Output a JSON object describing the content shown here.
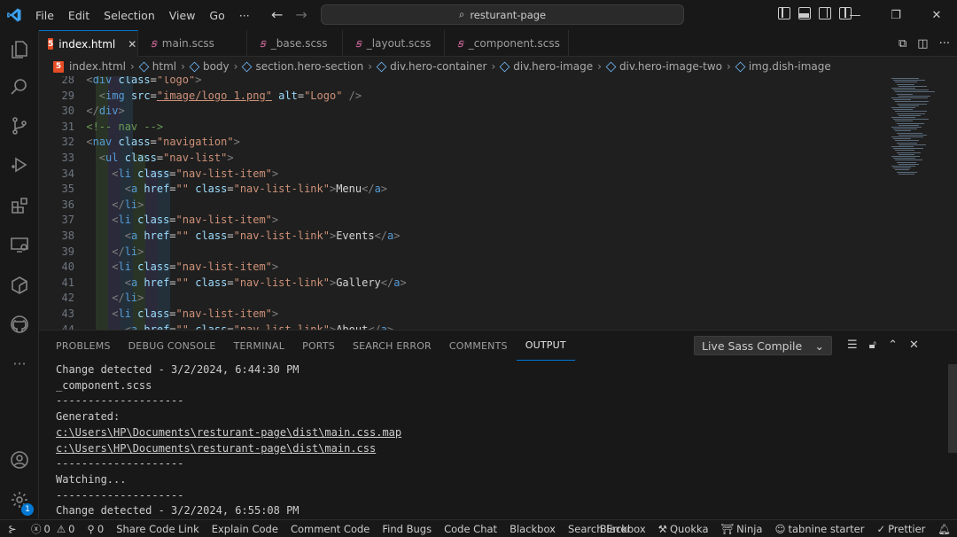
{
  "titlebar": {
    "menu": [
      "File",
      "Edit",
      "Selection",
      "View",
      "Go",
      "···"
    ],
    "search": "resturant-page"
  },
  "tabs": [
    {
      "label": "index.html",
      "kind": "html"
    },
    {
      "label": "main.scss",
      "kind": "scss"
    },
    {
      "label": "_base.scss",
      "kind": "scss"
    },
    {
      "label": "_layout.scss",
      "kind": "scss"
    },
    {
      "label": "_component.scss",
      "kind": "scss"
    }
  ],
  "breadcrumb": [
    "index.html",
    "html",
    "body",
    "section.hero-section",
    "div.hero-container",
    "div.hero-image",
    "div.hero-image-two",
    "img.dish-image"
  ],
  "editor": {
    "line_numbers": [
      "28",
      "29",
      "30",
      "31",
      "32",
      "33",
      "34",
      "35",
      "36",
      "37",
      "38",
      "39",
      "40",
      "41",
      "42",
      "43",
      "44"
    ]
  },
  "panel": {
    "tabs": [
      "PROBLEMS",
      "DEBUG CONSOLE",
      "TERMINAL",
      "PORTS",
      "SEARCH ERROR",
      "COMMENTS",
      "OUTPUT"
    ],
    "active_tab": "OUTPUT",
    "channel": "Live Sass Compile",
    "output": [
      "Change detected - 3/2/2024, 6:44:30 PM",
      "_component.scss",
      "--------------------",
      "Generated:",
      "c:\\Users\\HP\\Documents\\resturant-page\\dist\\main.css.map",
      "c:\\Users\\HP\\Documents\\resturant-page\\dist\\main.css",
      "--------------------",
      "Watching...",
      "--------------------",
      "Change detected - 3/2/2024, 6:55:08 PM"
    ]
  },
  "status": {
    "errors": "0",
    "warnings": "0",
    "ports": "0",
    "left_items": [
      "Share Code Link",
      "Explain Code",
      "Comment Code",
      "Find Bugs",
      "Code Chat",
      "Blackbox",
      "Search Error"
    ],
    "right_items": [
      "Blackbox",
      "Quokka",
      "Ninja",
      "tabnine starter",
      "Prettier"
    ]
  },
  "activity_badge": "1",
  "colors": {
    "accent": "#0078d4",
    "html": "#e44d26",
    "sass": "#cd6799"
  }
}
